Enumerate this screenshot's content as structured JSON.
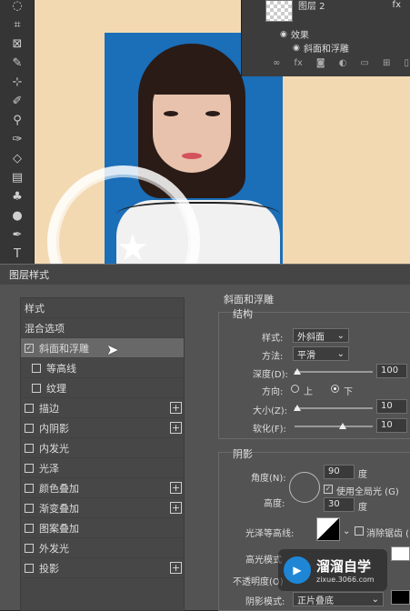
{
  "layers_panel": {
    "layer_name": "图层 2",
    "effects_label": "效果",
    "effect_item": "斜面和浮雕",
    "fx_label": "fx"
  },
  "tools": [
    "ellipse-select-icon",
    "crop-icon",
    "frame-icon",
    "eyedropper-icon",
    "patch-icon",
    "brush-icon",
    "stamp-icon",
    "history-brush-icon",
    "eraser-icon",
    "gradient-icon",
    "blur-icon",
    "dodge-icon",
    "pen-icon",
    "type-icon"
  ],
  "dialog": {
    "title": "图层样式",
    "styles_list": {
      "header": "样式",
      "blend_options": "混合选项",
      "items": [
        {
          "label": "斜面和浮雕",
          "checked": true,
          "active": true,
          "indent": false,
          "plus": false
        },
        {
          "label": "等高线",
          "checked": false,
          "active": false,
          "indent": true,
          "plus": false
        },
        {
          "label": "纹理",
          "checked": false,
          "active": false,
          "indent": true,
          "plus": false
        },
        {
          "label": "描边",
          "checked": false,
          "active": false,
          "indent": false,
          "plus": true
        },
        {
          "label": "内阴影",
          "checked": false,
          "active": false,
          "indent": false,
          "plus": true
        },
        {
          "label": "内发光",
          "checked": false,
          "active": false,
          "indent": false,
          "plus": false
        },
        {
          "label": "光泽",
          "checked": false,
          "active": false,
          "indent": false,
          "plus": false
        },
        {
          "label": "颜色叠加",
          "checked": false,
          "active": false,
          "indent": false,
          "plus": true
        },
        {
          "label": "渐变叠加",
          "checked": false,
          "active": false,
          "indent": false,
          "plus": true
        },
        {
          "label": "图案叠加",
          "checked": false,
          "active": false,
          "indent": false,
          "plus": false
        },
        {
          "label": "外发光",
          "checked": false,
          "active": false,
          "indent": false,
          "plus": false
        },
        {
          "label": "投影",
          "checked": false,
          "active": false,
          "indent": false,
          "plus": true
        }
      ]
    },
    "bevel": {
      "section_title": "斜面和浮雕",
      "structure_title": "结构",
      "style_label": "样式:",
      "style_value": "外斜面",
      "technique_label": "方法:",
      "technique_value": "平滑",
      "depth_label": "深度(D):",
      "depth_value": "100",
      "depth_level": 0.04,
      "direction_label": "方向:",
      "dir_up": "上",
      "dir_down": "下",
      "direction_selected": "down",
      "size_label": "大小(Z):",
      "size_value": "10",
      "size_level": 0.04,
      "soften_label": "软化(F):",
      "soften_value": "10",
      "soften_level": 0.62
    },
    "shading": {
      "title": "阴影",
      "angle_label": "角度(N):",
      "angle_value": "90",
      "degree": "度",
      "global_light_label": "使用全局光 (G)",
      "global_light_checked": true,
      "altitude_label": "高度:",
      "altitude_value": "30",
      "contour_label": "光泽等高线:",
      "antialias_label": "消除锯齿 (L)",
      "highlight_mode_label": "高光模式",
      "opacity_label": "不透明度(O)",
      "shadow_mode_label": "阴影模式:",
      "shadow_mode_value": "正片叠底"
    }
  },
  "watermark": {
    "name": "溜溜自学",
    "url": "zixue.3066.com"
  },
  "colors": {
    "canvas_bg": "#f3d9b2",
    "photo_blue": "#1b6eb8",
    "dialog_bg": "#535353",
    "active_item": "#686868"
  }
}
